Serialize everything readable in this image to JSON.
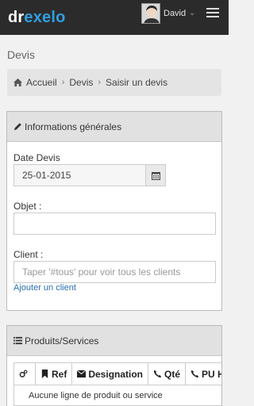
{
  "header": {
    "logo_part1": "dr",
    "logo_part2": "exelo",
    "username": "David",
    "colors": {
      "bar": "#2b2b2b",
      "logo_accent": "#2f9fe0"
    }
  },
  "page": {
    "title": "Devis"
  },
  "breadcrumb": {
    "items": [
      "Accueil",
      "Devis",
      "Saisir un devis"
    ]
  },
  "general_panel": {
    "title": "Informations générales",
    "date_label": "Date Devis",
    "date_value": "25-01-2015",
    "objet_label": "Objet :",
    "objet_value": "",
    "client_label": "Client :",
    "client_placeholder": "Taper '#tous' pour voir tous les clients",
    "add_client_link": "Ajouter un client"
  },
  "products_panel": {
    "title": "Produits/Services",
    "columns": [
      "Ref",
      "Designation",
      "Qté",
      "PU HT"
    ],
    "empty_message": "Aucune ligne de produit ou service"
  }
}
